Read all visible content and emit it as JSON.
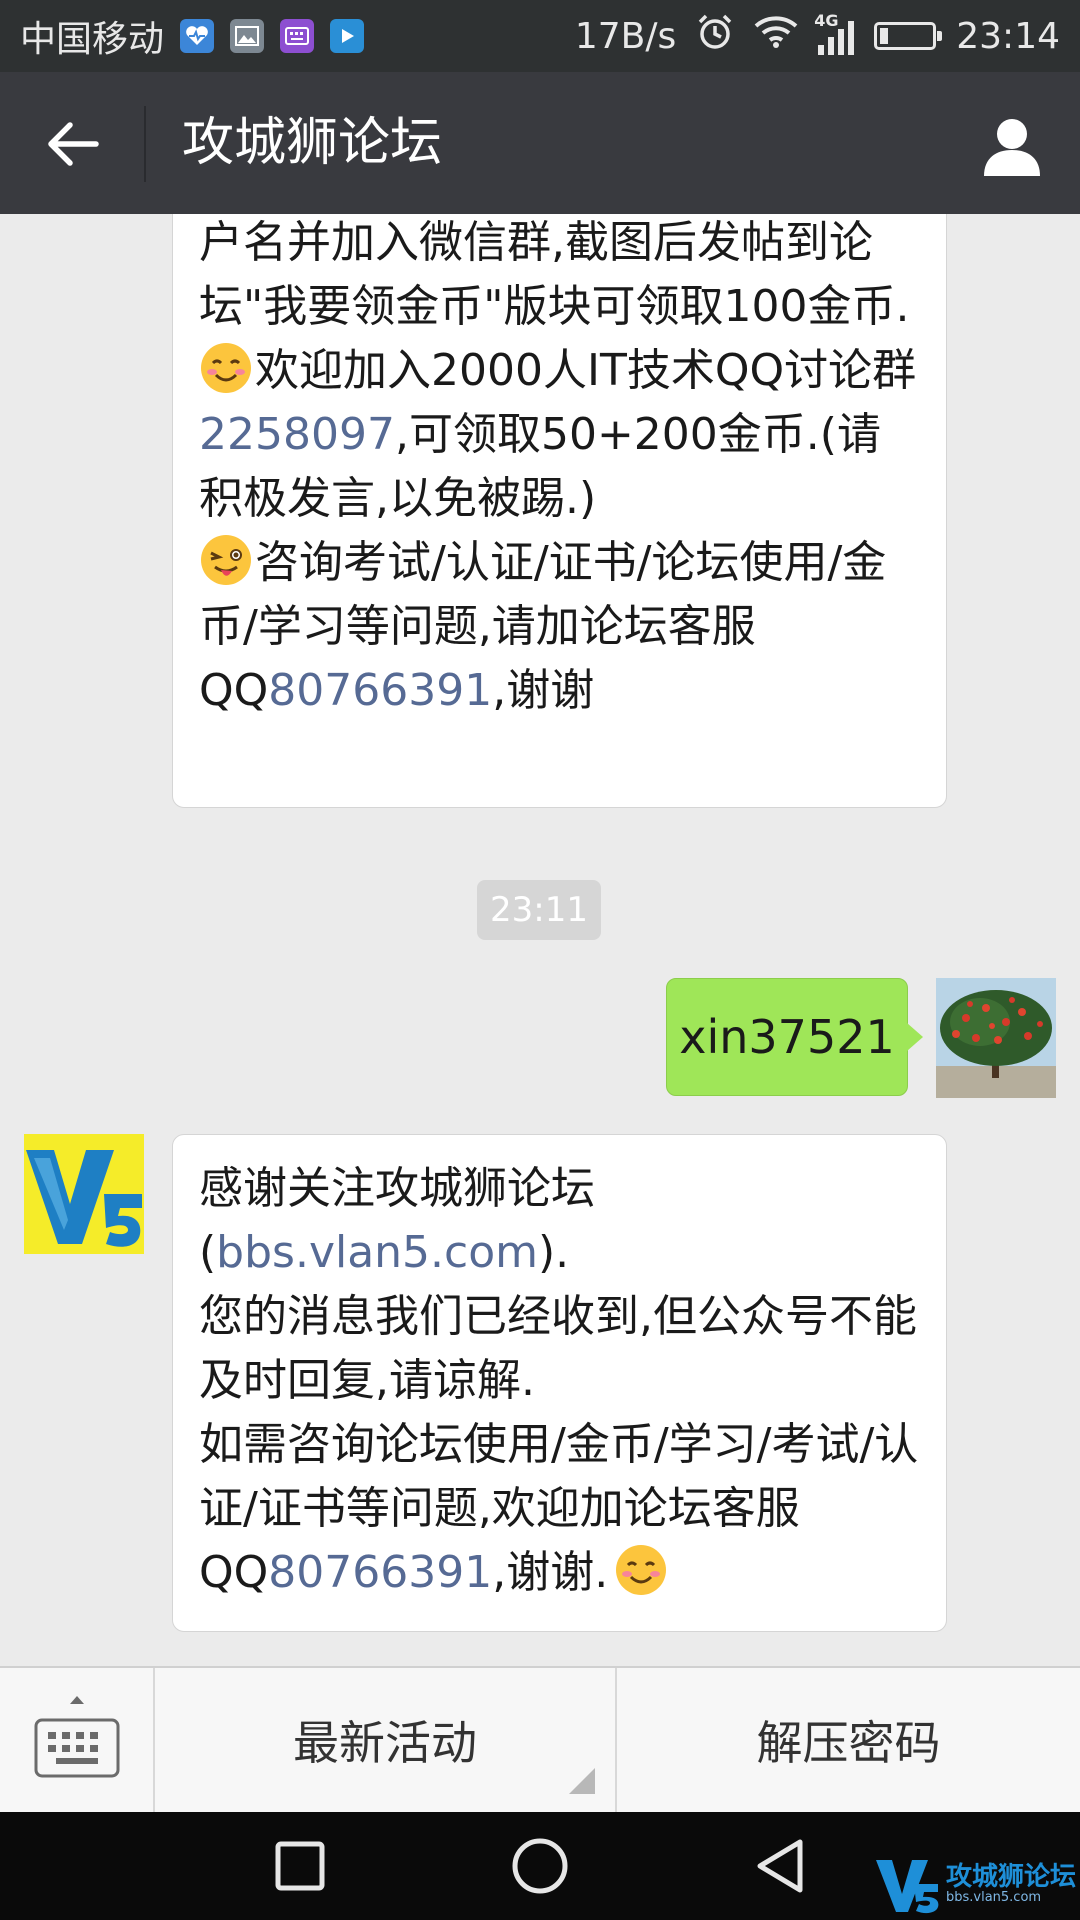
{
  "status_bar": {
    "carrier": "中国移动",
    "speed": "17B/s",
    "network": "4G",
    "time": "23:14",
    "app_icons": [
      "health-icon",
      "gallery-icon",
      "keyboard-app-icon",
      "video-icon"
    ]
  },
  "header": {
    "title": "攻城狮论坛"
  },
  "messages": {
    "first": {
      "line1": "户名并加入微信群,截图后发帖到论坛\"我要领金币\"版块可领取100金币.",
      "line2_a": "欢迎加入2000人IT技术QQ讨论群",
      "line2_link": "2258097",
      "line2_b": ",可领取50+200金币.(请积极发言,以免被踢.)",
      "line3_a": "咨询考试/认证/证书/论坛使用/金币/学习等问题,请加论坛客服QQ",
      "line3_link": "80766391",
      "line3_b": ",谢谢"
    },
    "timestamp": "23:11",
    "sent": "xin37521",
    "reply": {
      "line1": "感谢关注攻城狮论坛(",
      "line1_link": "bbs.vlan5.com",
      "line1_b": ").",
      "line2": "您的消息我们已经收到,但公众号不能及时回复,请谅解.",
      "line3_a": "如需咨询论坛使用/金币/学习/考试/认证/证书等问题,欢迎加论坛客服QQ",
      "line3_link": "80766391",
      "line3_b": ",谢谢."
    }
  },
  "menu": {
    "item1": "最新活动",
    "item2": "解压密码"
  },
  "watermark": {
    "logo": "V5",
    "name": "攻城狮论坛",
    "url": "bbs.vlan5.com"
  },
  "colors": {
    "status_bar": "#2e3132",
    "title_bar": "#393a3f",
    "sent_bubble": "#9fe658",
    "link": "#566a94"
  }
}
